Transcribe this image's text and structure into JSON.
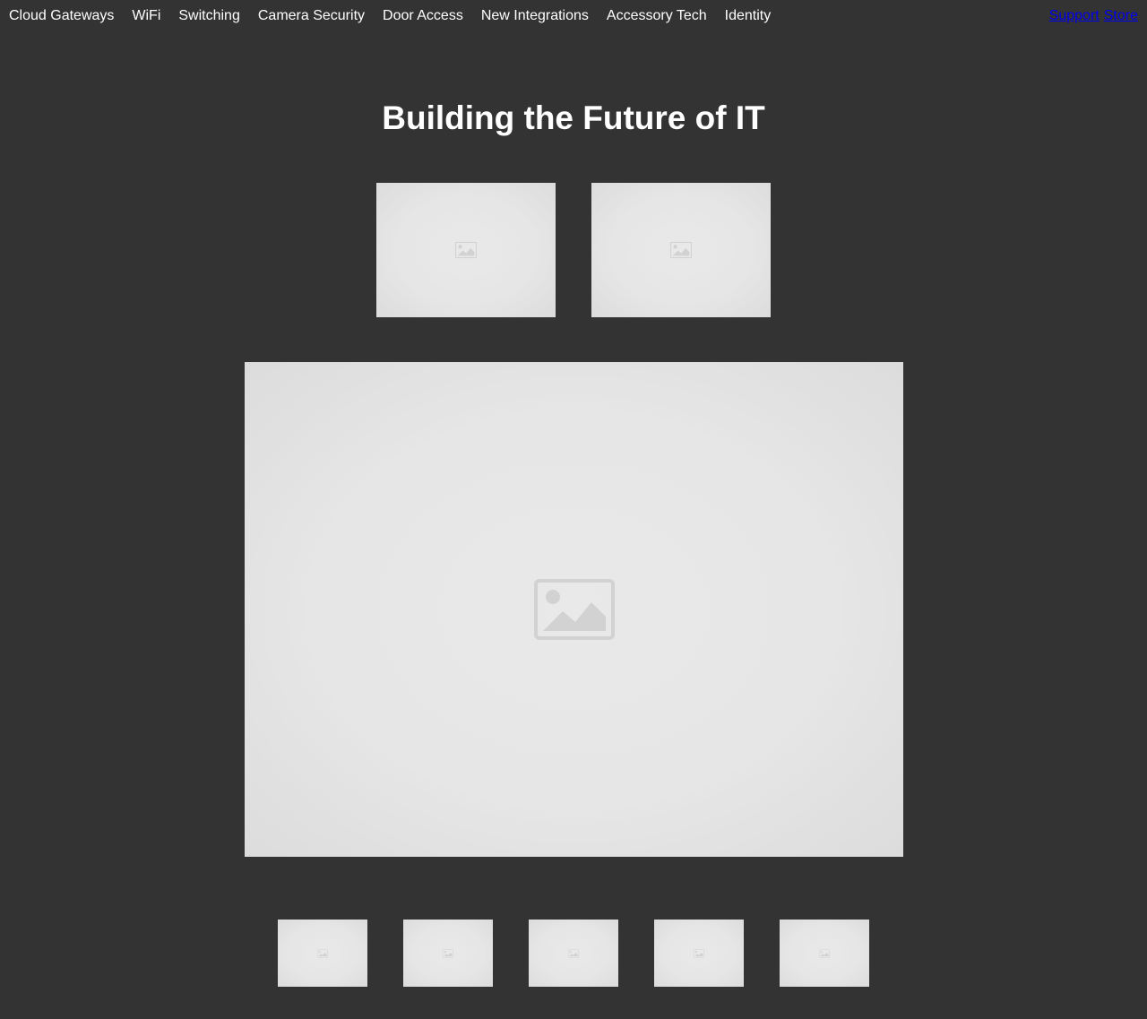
{
  "nav": {
    "items": [
      {
        "label": "Cloud Gateways"
      },
      {
        "label": "WiFi"
      },
      {
        "label": "Switching"
      },
      {
        "label": "Camera Security"
      },
      {
        "label": "Door Access"
      },
      {
        "label": "New Integrations"
      },
      {
        "label": "Accessory Tech"
      },
      {
        "label": "Identity"
      }
    ],
    "links": [
      {
        "label": "Support"
      },
      {
        "label": "Store"
      }
    ]
  },
  "hero": {
    "title": "Building the Future of IT"
  },
  "colors": {
    "background": "#333333",
    "text": "#ffffff",
    "link": "#0000ee",
    "placeholder": "#e6e6e6"
  },
  "media": {
    "icon": "image-placeholder-icon"
  }
}
